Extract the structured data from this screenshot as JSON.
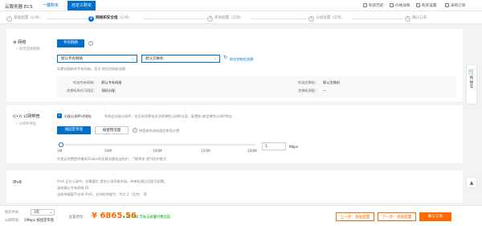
{
  "header": {
    "brand": "云服务器 ECS",
    "mode_tabs": [
      "一键购买",
      "自定义购买"
    ],
    "links": [
      "购买历史",
      "价格详情",
      "购买设置",
      "采购订单"
    ]
  },
  "steps": [
    {
      "num": "✓",
      "label": "基础配置",
      "mode": "(必填)"
    },
    {
      "num": "2",
      "label": "网络和安全组",
      "mode": "(必填)"
    },
    {
      "num": "3",
      "label": "系统配置",
      "mode": "(选填)"
    },
    {
      "num": "4",
      "label": "分组设置",
      "mode": "(选填)"
    },
    {
      "num": "5",
      "label": "确认订单",
      "mode": ""
    }
  ],
  "network": {
    "title": "网络",
    "subtitle": "• 如何选择网络",
    "type_button": "专有网络",
    "vpc_value": "默认专有网络",
    "vswitch_value": "默认交换机",
    "console_link": "前往控制台创建",
    "note": "如需创建新的专有网络，您可 前往控制台创建",
    "info_left": [
      {
        "k": "所选专有网络：",
        "v": "默认专有网络"
      },
      {
        "k": "交换机所在可用区：",
        "v": "随机分配"
      }
    ],
    "info_right": [
      {
        "k": "所选交换机：",
        "v": "默认交换机"
      },
      {
        "k": "交换机网段：",
        "v": "—"
      }
    ]
  },
  "bandwidth": {
    "title": "公网带宽",
    "subtitle": "• 公网IP地址",
    "checkbox_label": "分配公网IPv4地址",
    "checkbox_note": "系统会分配公网IP，也可采用更加灵活的弹性公网IP方案，配置和 绑定弹性公网IP地址",
    "billing_options": [
      "按固定带宽",
      "按使用流量"
    ],
    "billing_note": "带宽按所选的固定带宽计费",
    "ticks": [
      "1M",
      "50M",
      "100M",
      "150M",
      "200M"
    ],
    "bandwidth_value": "1",
    "unit": "Mbps",
    "level": 0.01,
    "note": "阿里云免费提供最高5Gbps的恶意流量攻击防护，了解更多 提升防护能力"
  },
  "ipv6": {
    "title": "IPv6",
    "lines": [
      "IPv6 正在公测中，如需要在 提交公测资格申请，待审核通过后即可配置。",
      "请先确认专有网络 ID",
      "当前地域暂不支持 IPv6，支持的地域为：华北 2（北京） 等"
    ]
  },
  "footer": {
    "duration_label": "购买时长：",
    "duration_value": "1年",
    "bandwidth_label": "公网带宽：",
    "bandwidth_value": "1Mbps 按固定带宽",
    "fee_label": "配置费用：",
    "price": "¥ 6865.56",
    "discount": "¥ 357.08 节省与按量付费比较",
    "prev_button": "上一步：基础配置",
    "next_button": "下一步：系统配置",
    "confirm_button": "确认订单"
  },
  "float": {
    "cart": "购物车",
    "top": "▲"
  },
  "colors": {
    "accent": "#0070cc",
    "price": "#ff6a00"
  }
}
